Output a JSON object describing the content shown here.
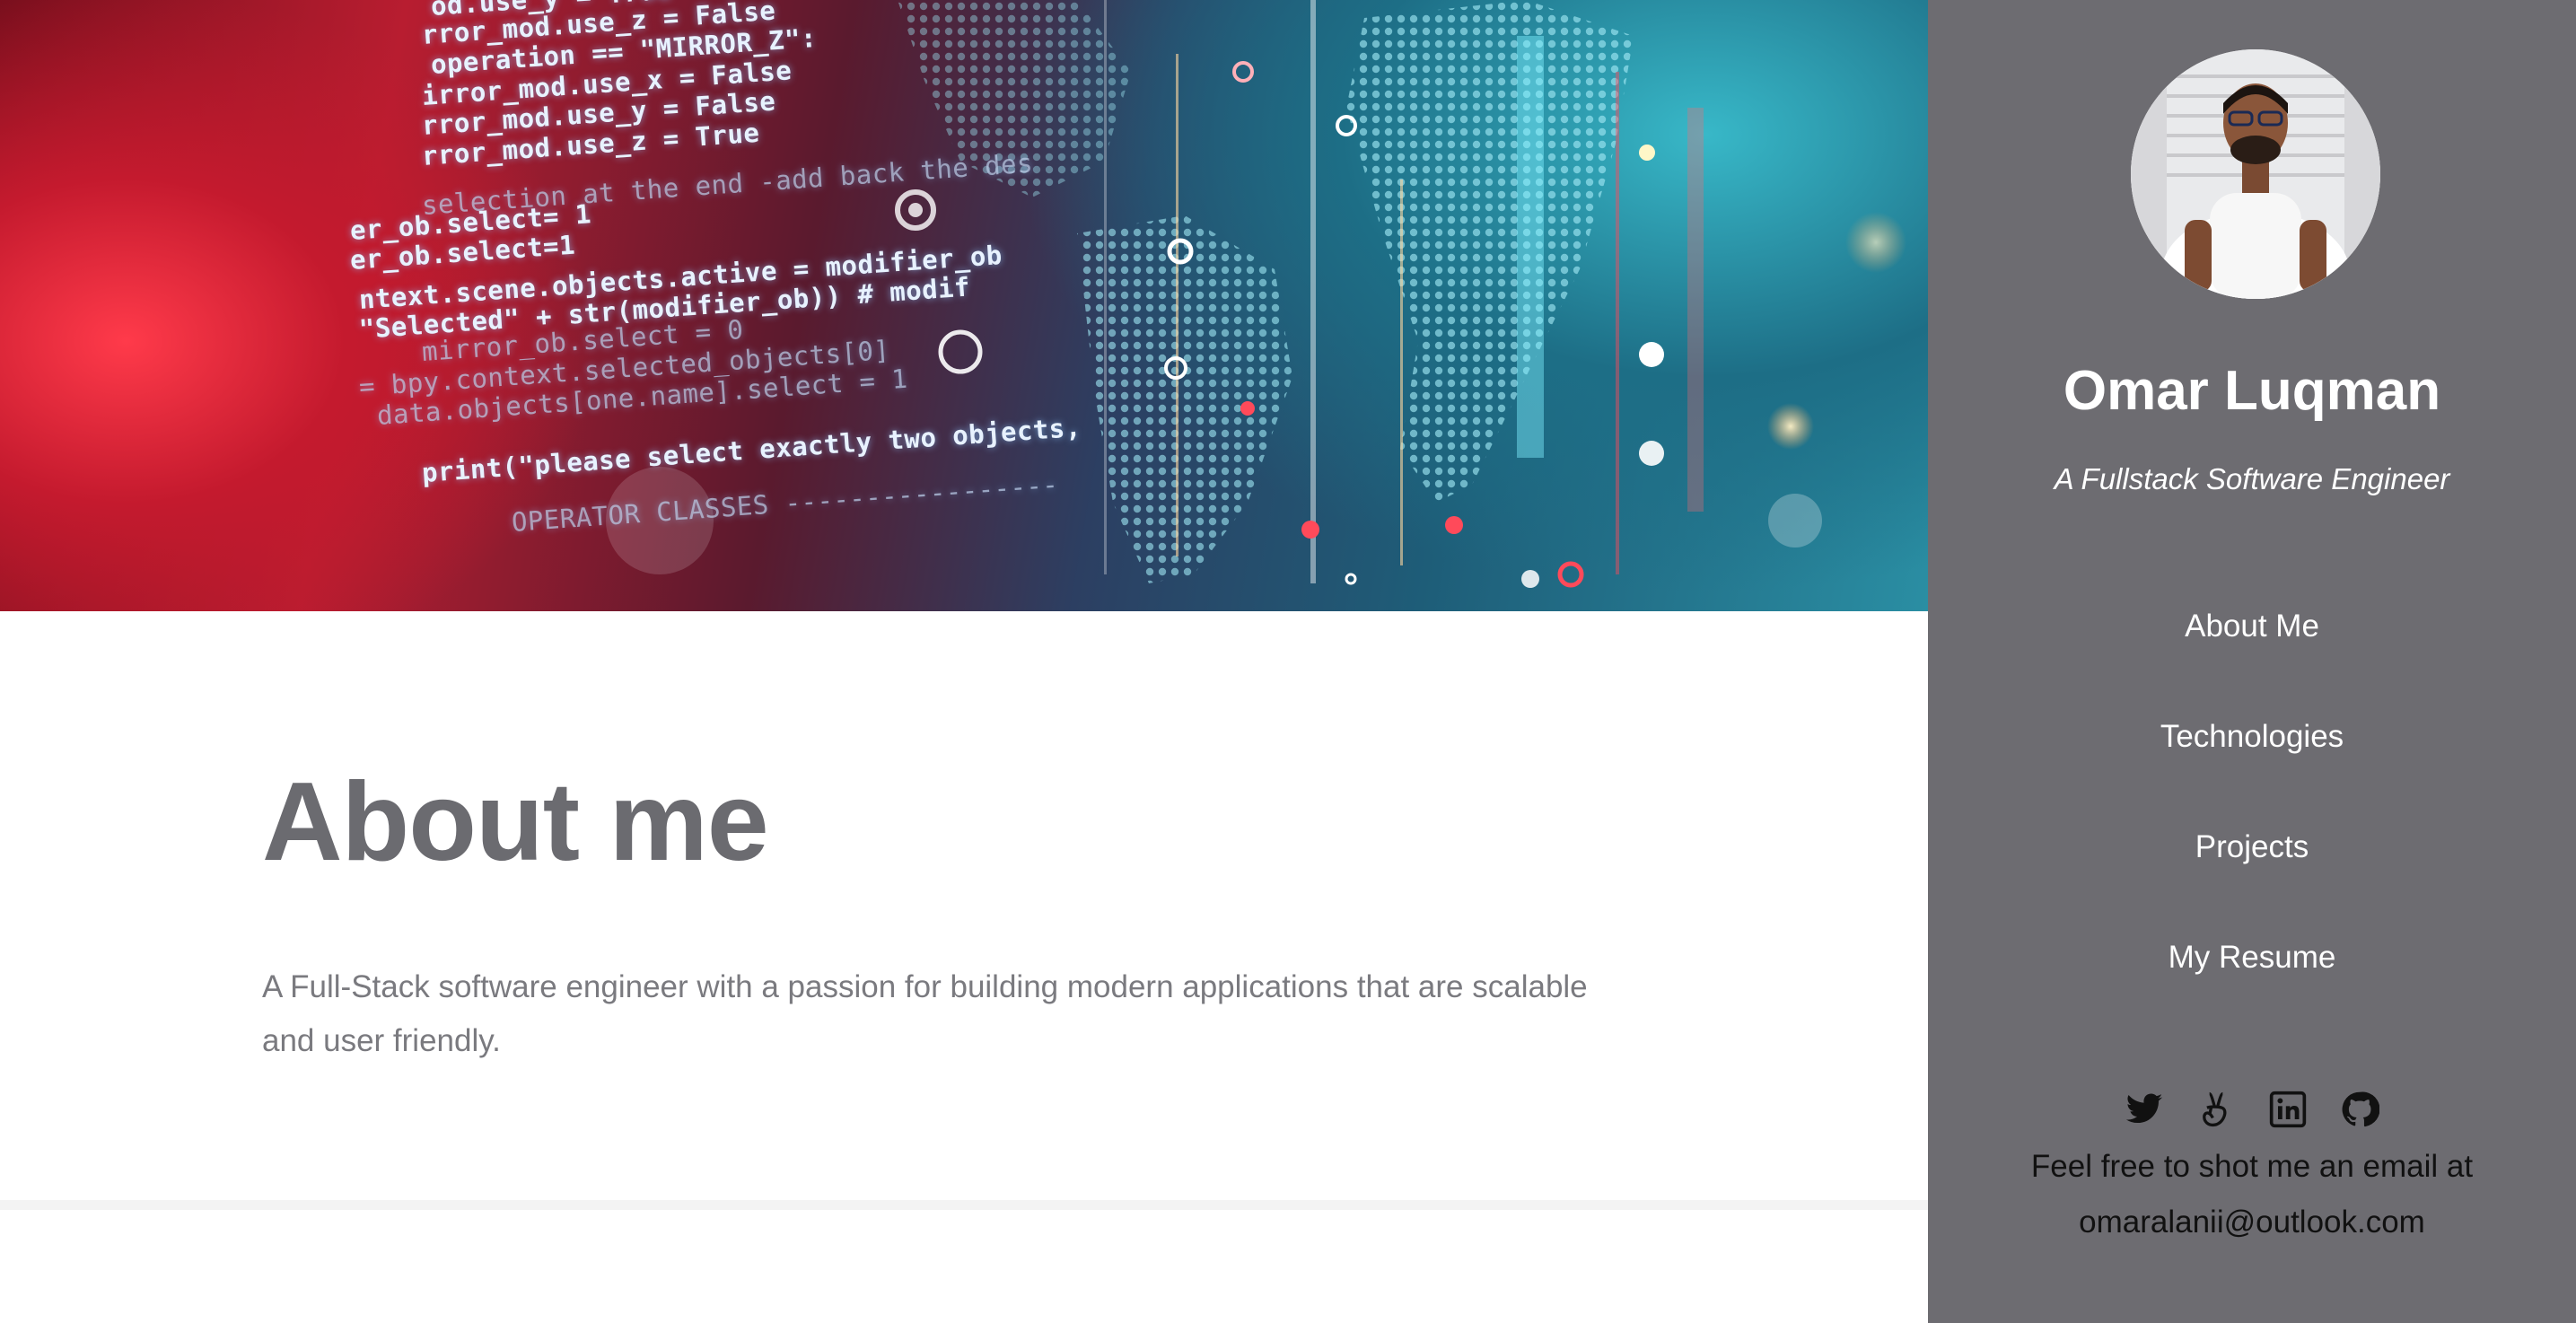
{
  "hero": {
    "code_lines": [
      "od.use_y = True",
      "rror_mod.use_z = False",
      "operation == \"MIRROR_Z\":",
      "irror_mod.use_x = False",
      "rror_mod.use_y = False",
      "rror_mod.use_z = True",
      "selection at the end -add back the des",
      "er_ob.select= 1",
      "er_ob.select=1",
      "ntext.scene.objects.active = modifier_ob",
      "\"Selected\" + str(modifier_ob)) # modif",
      "mirror_ob.select = 0",
      "= bpy.context.selected_objects[0]",
      "data.objects[one.name].select = 1",
      "print(\"please select exactly two objects,",
      "OPERATOR CLASSES -----------------"
    ]
  },
  "main": {
    "title": "About me",
    "description": "A Full-Stack software engineer with a passion for building modern applications that are scalable and user friendly."
  },
  "sidebar": {
    "name": "Omar Luqman",
    "tagline": "A Fullstack Software Engineer",
    "nav": [
      {
        "label": "About Me"
      },
      {
        "label": "Technologies"
      },
      {
        "label": "Projects"
      },
      {
        "label": "My Resume"
      }
    ],
    "social_icons": [
      "twitter-icon",
      "angellist-icon",
      "linkedin-icon",
      "github-icon"
    ],
    "contact_line": "Feel free to shot me an email at",
    "email": "omaralanii@outlook.com",
    "colors": {
      "background": "#6d6c71",
      "text": "#ffffff",
      "email_text": "#111111"
    }
  }
}
